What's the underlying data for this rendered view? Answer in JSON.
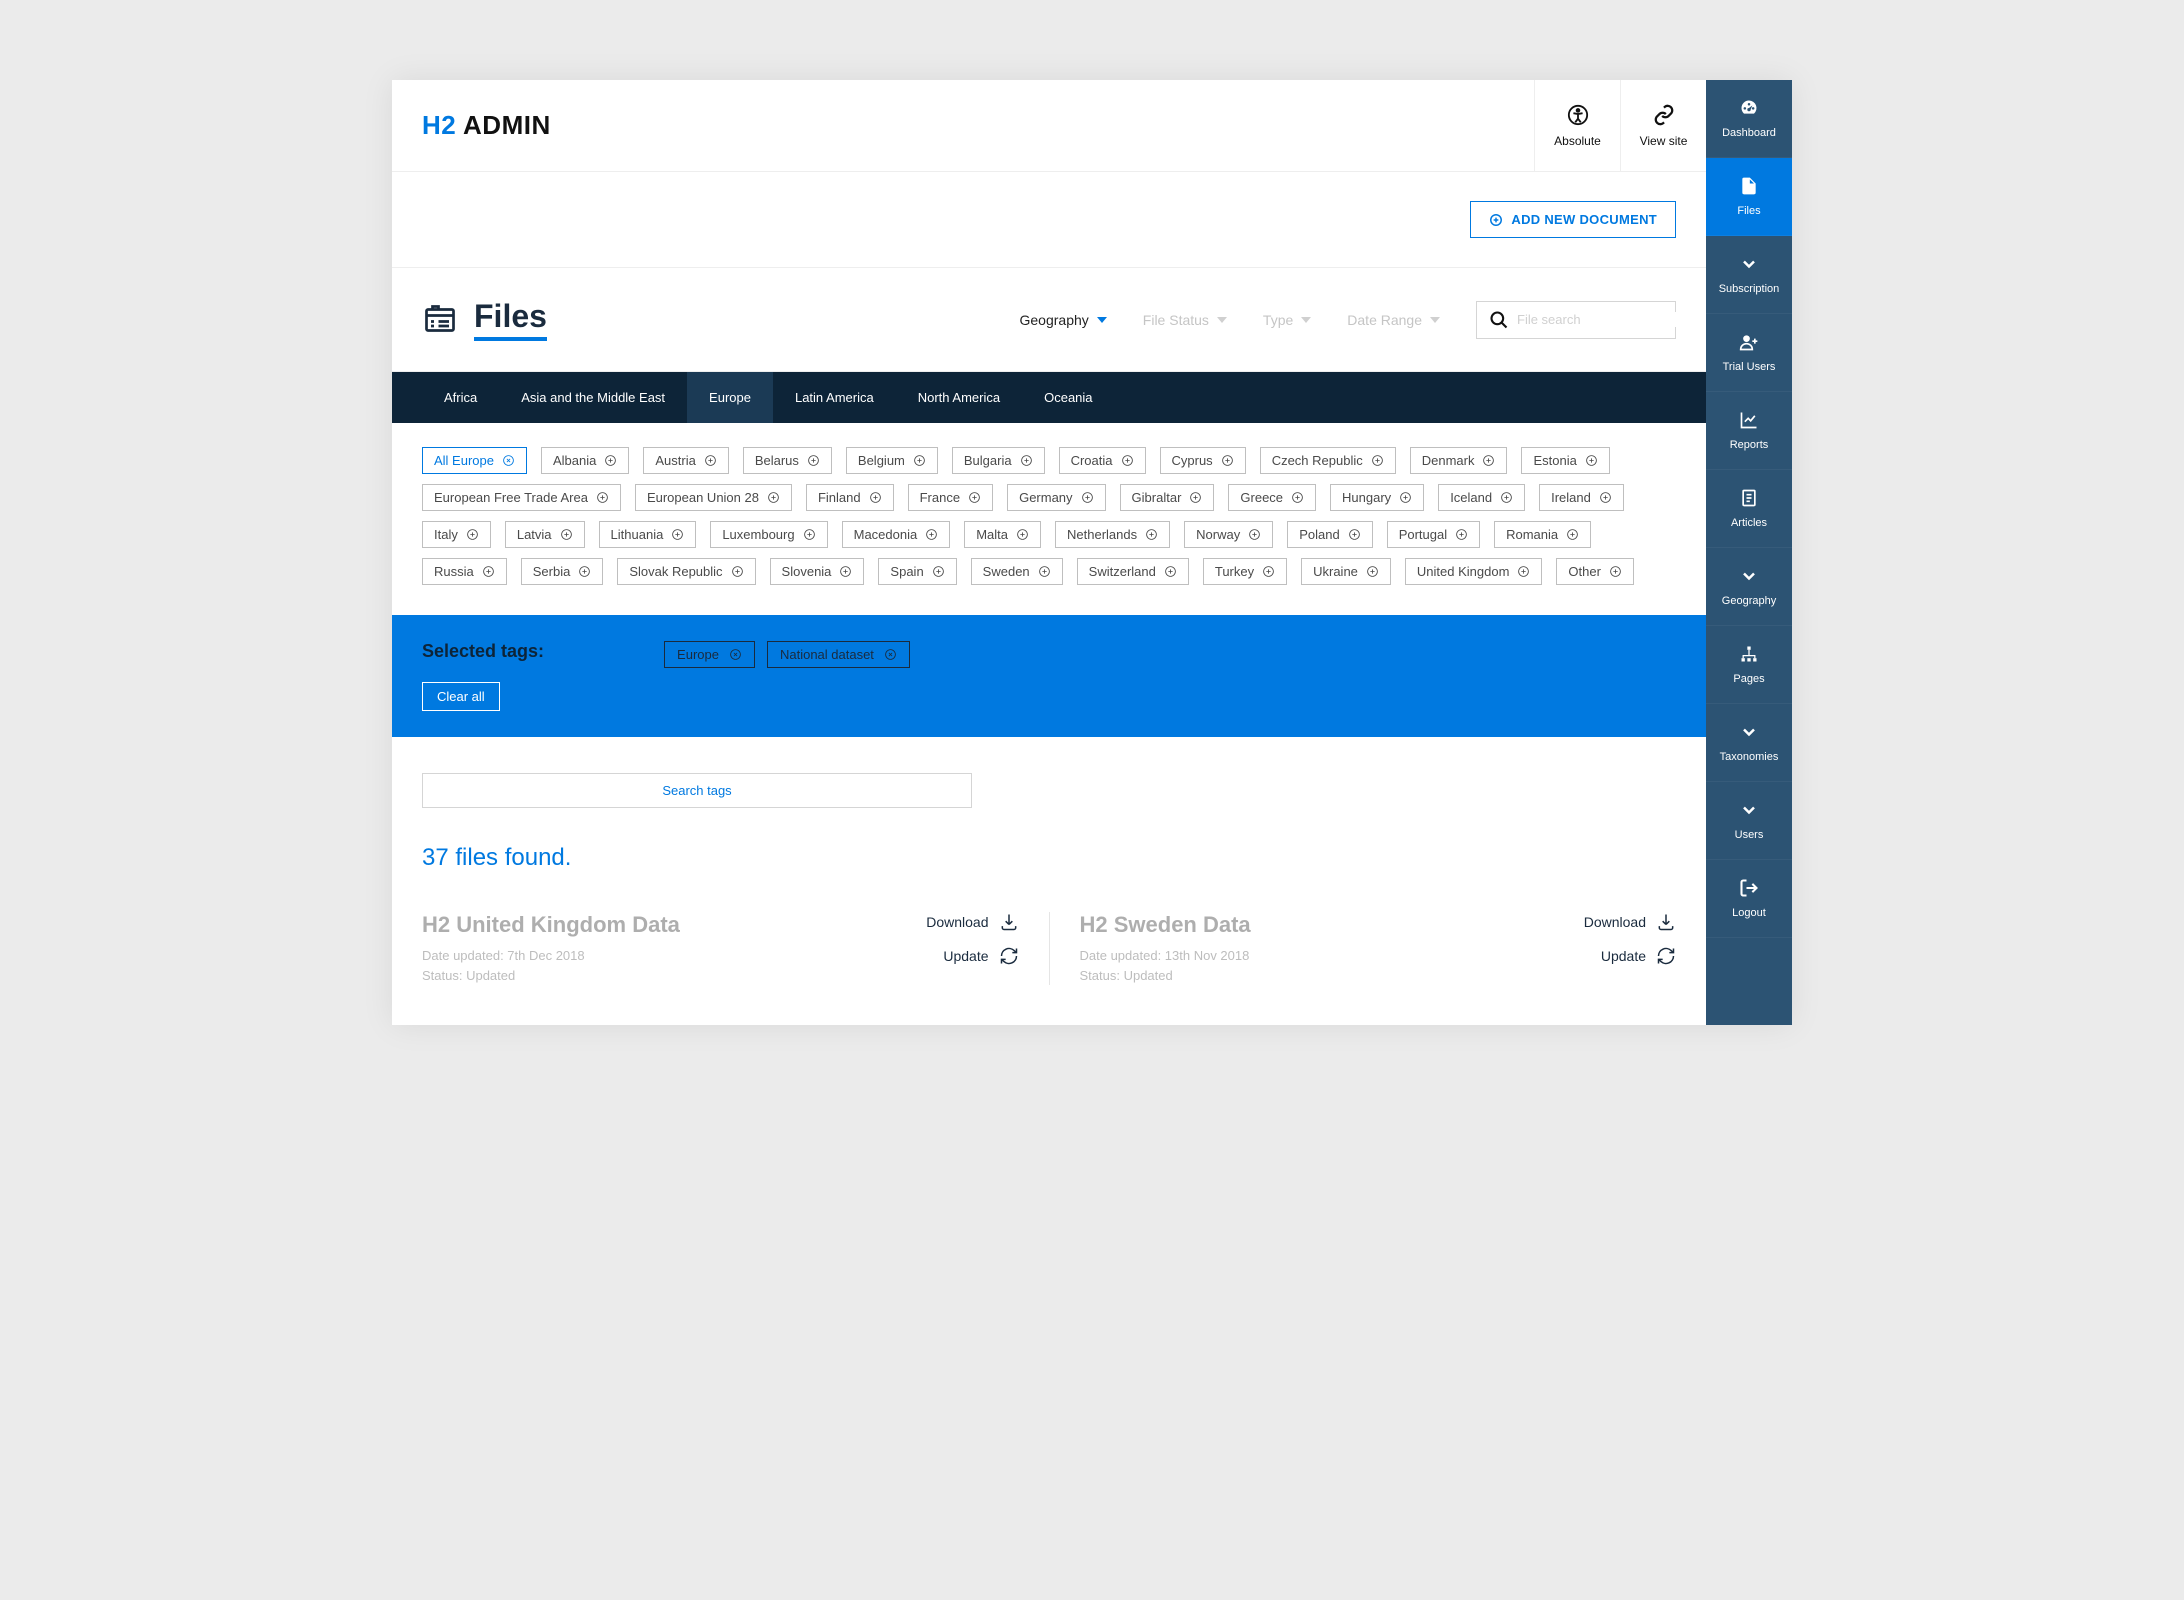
{
  "brand": {
    "prefix": "H2",
    "suffix": "ADMIN"
  },
  "top_actions": {
    "absolute": "Absolute",
    "view_site": "View site"
  },
  "add_document_label": "ADD NEW DOCUMENT",
  "page_title": "Files",
  "filters": {
    "geography": "Geography",
    "file_status": "File Status",
    "type": "Type",
    "date_range": "Date Range"
  },
  "search_placeholder": "File search",
  "regions": [
    "Africa",
    "Asia and the Middle East",
    "Europe",
    "Latin America",
    "North America",
    "Oceania"
  ],
  "active_region": "Europe",
  "tags": [
    {
      "label": "All Europe",
      "selected": true
    },
    {
      "label": "Albania"
    },
    {
      "label": "Austria"
    },
    {
      "label": "Belarus"
    },
    {
      "label": "Belgium"
    },
    {
      "label": "Bulgaria"
    },
    {
      "label": "Croatia"
    },
    {
      "label": "Cyprus"
    },
    {
      "label": "Czech Republic"
    },
    {
      "label": "Denmark"
    },
    {
      "label": "Estonia"
    },
    {
      "label": "European Free Trade Area"
    },
    {
      "label": "European Union 28"
    },
    {
      "label": "Finland"
    },
    {
      "label": "France"
    },
    {
      "label": "Germany"
    },
    {
      "label": "Gibraltar"
    },
    {
      "label": "Greece"
    },
    {
      "label": "Hungary"
    },
    {
      "label": "Iceland"
    },
    {
      "label": "Ireland"
    },
    {
      "label": "Italy"
    },
    {
      "label": "Latvia"
    },
    {
      "label": "Lithuania"
    },
    {
      "label": "Luxembourg"
    },
    {
      "label": "Macedonia"
    },
    {
      "label": "Malta"
    },
    {
      "label": "Netherlands"
    },
    {
      "label": "Norway"
    },
    {
      "label": "Poland"
    },
    {
      "label": "Portugal"
    },
    {
      "label": "Romania"
    },
    {
      "label": "Russia"
    },
    {
      "label": "Serbia"
    },
    {
      "label": "Slovak Republic"
    },
    {
      "label": "Slovenia"
    },
    {
      "label": "Spain"
    },
    {
      "label": "Sweden"
    },
    {
      "label": "Switzerland"
    },
    {
      "label": "Turkey"
    },
    {
      "label": "Ukraine"
    },
    {
      "label": "United Kingdom"
    },
    {
      "label": "Other"
    }
  ],
  "selected_tags_label": "Selected tags:",
  "selected_tags": [
    "Europe",
    "National dataset"
  ],
  "clear_all_label": "Clear all",
  "search_tags_placeholder": "Search tags",
  "results_found_label": "37 files found.",
  "results": [
    {
      "title": "H2 United Kingdom Data",
      "date": "Date updated: 7th Dec 2018",
      "status": "Status: Updated"
    },
    {
      "title": "H2 Sweden Data",
      "date": "Date updated: 13th Nov 2018",
      "status": "Status: Updated"
    }
  ],
  "result_actions": {
    "download": "Download",
    "update": "Update"
  },
  "sidebar": [
    {
      "label": "Dashboard",
      "icon": "gauge",
      "active": false
    },
    {
      "label": "Files",
      "icon": "file",
      "active": true
    },
    {
      "label": "Subscription",
      "icon": "chevron",
      "active": false
    },
    {
      "label": "Trial Users",
      "icon": "user-plus",
      "active": false
    },
    {
      "label": "Reports",
      "icon": "chart",
      "active": false
    },
    {
      "label": "Articles",
      "icon": "doc",
      "active": false
    },
    {
      "label": "Geography",
      "icon": "chevron",
      "active": false
    },
    {
      "label": "Pages",
      "icon": "sitemap",
      "active": false
    },
    {
      "label": "Taxonomies",
      "icon": "chevron",
      "active": false
    },
    {
      "label": "Users",
      "icon": "chevron",
      "active": false
    },
    {
      "label": "Logout",
      "icon": "logout",
      "active": false
    }
  ]
}
